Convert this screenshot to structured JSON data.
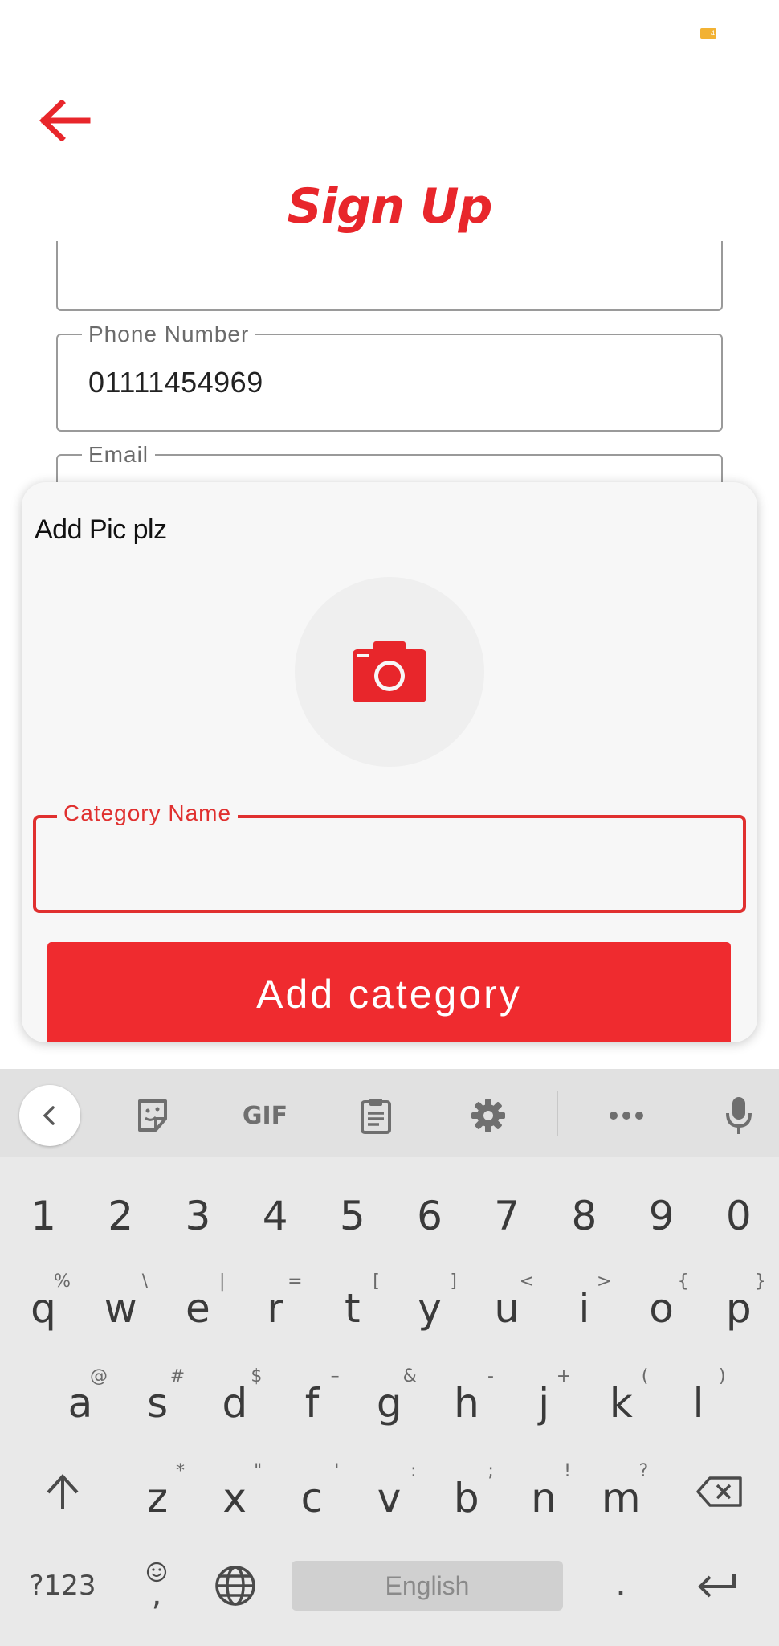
{
  "status_bar": {
    "battery_level": "4"
  },
  "header": {
    "title": "Sign Up"
  },
  "form": {
    "phone": {
      "label": "Phone Number",
      "value": "01111454969"
    },
    "email": {
      "label": "Email"
    }
  },
  "dialog": {
    "title": "Add Pic plz",
    "category_field": {
      "label": "Category Name",
      "value": ""
    },
    "submit_label": "Add category",
    "accent_color": "#ef2b2f"
  },
  "keyboard": {
    "toolbar": {
      "gif_label": "GIF"
    },
    "number_row": [
      "1",
      "2",
      "3",
      "4",
      "5",
      "6",
      "7",
      "8",
      "9",
      "0"
    ],
    "row1": [
      {
        "k": "q",
        "s": "%"
      },
      {
        "k": "w",
        "s": "\\"
      },
      {
        "k": "e",
        "s": "|"
      },
      {
        "k": "r",
        "s": "="
      },
      {
        "k": "t",
        "s": "["
      },
      {
        "k": "y",
        "s": "]"
      },
      {
        "k": "u",
        "s": "<"
      },
      {
        "k": "i",
        "s": ">"
      },
      {
        "k": "o",
        "s": "{"
      },
      {
        "k": "p",
        "s": "}"
      }
    ],
    "row2": [
      {
        "k": "a",
        "s": "@"
      },
      {
        "k": "s",
        "s": "#"
      },
      {
        "k": "d",
        "s": "$"
      },
      {
        "k": "f",
        "s": "–"
      },
      {
        "k": "g",
        "s": "&"
      },
      {
        "k": "h",
        "s": "-"
      },
      {
        "k": "j",
        "s": "+"
      },
      {
        "k": "k",
        "s": "("
      },
      {
        "k": "l",
        "s": ")"
      }
    ],
    "row3": [
      {
        "k": "z",
        "s": "*"
      },
      {
        "k": "x",
        "s": "\""
      },
      {
        "k": "c",
        "s": "'"
      },
      {
        "k": "v",
        "s": ":"
      },
      {
        "k": "b",
        "s": ";"
      },
      {
        "k": "n",
        "s": "!"
      },
      {
        "k": "m",
        "s": "?"
      }
    ],
    "symbols_label": "?123",
    "comma_label": ",",
    "space_label": "English",
    "period_label": "."
  }
}
